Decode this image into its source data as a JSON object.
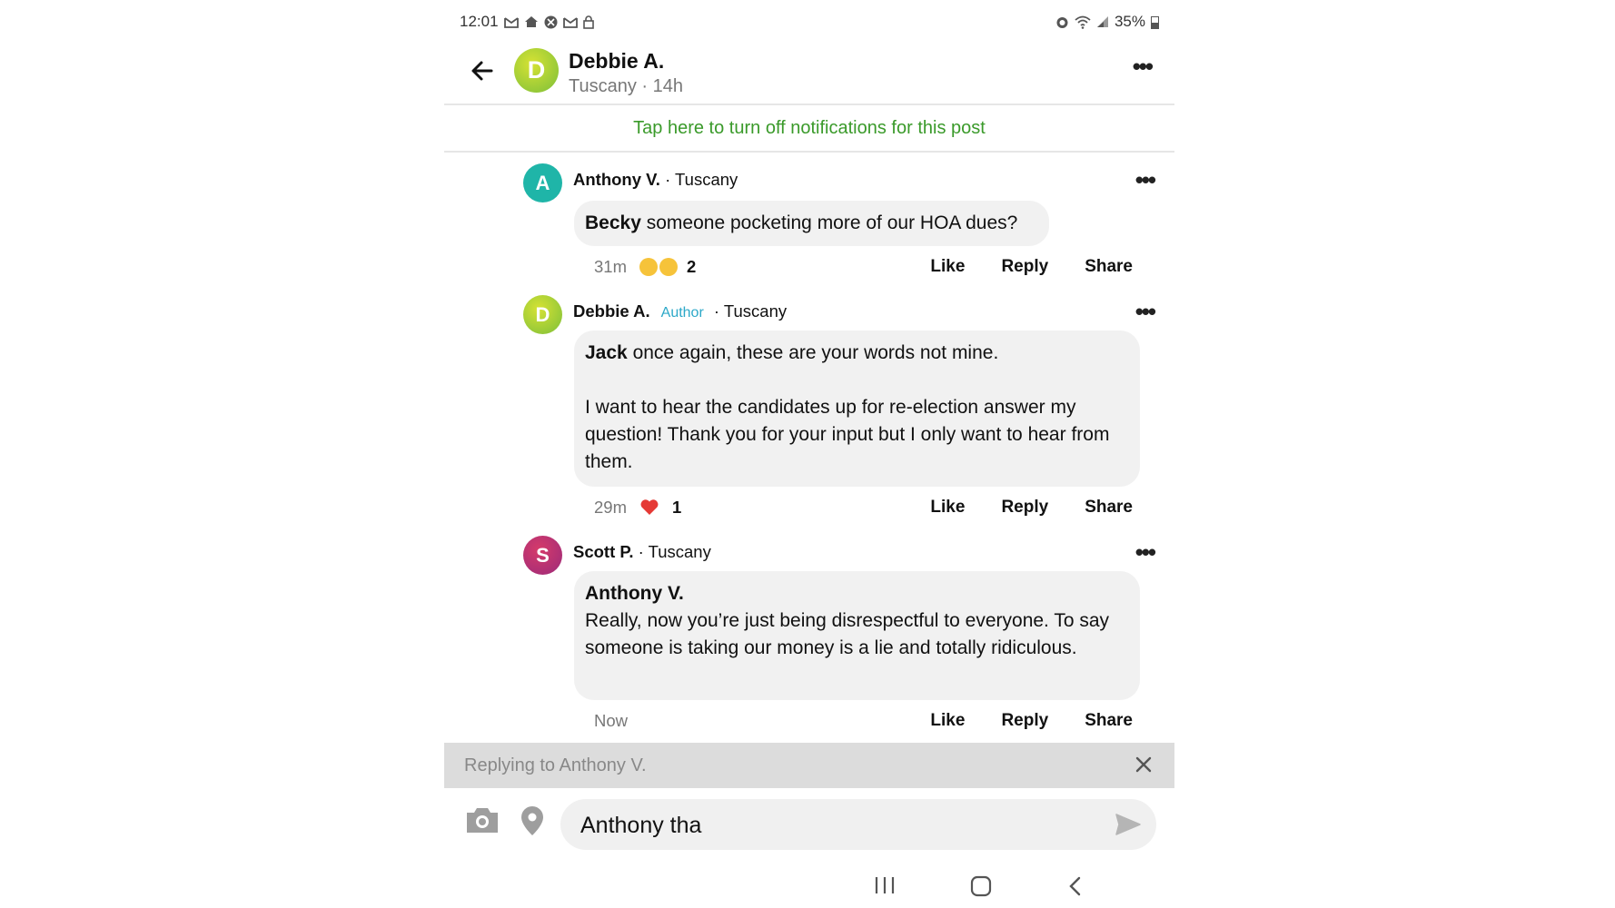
{
  "status_bar": {
    "time": "12:01",
    "battery": "35%",
    "left_icons": [
      "gmail-icon",
      "home-icon",
      "app-icon",
      "gmail-icon",
      "lock-icon"
    ],
    "right_icons": [
      "alarm-icon",
      "wifi-icon",
      "signal-icon",
      "battery-icon"
    ]
  },
  "header": {
    "avatar_letter": "D",
    "name": "Debbie A.",
    "neighborhood": "Tuscany",
    "time": "14h",
    "subtitle": "Tuscany · 14h"
  },
  "notification_banner": "Tap here to turn off notifications for this post",
  "comments": [
    {
      "avatar_letter": "A",
      "avatar_color": "#1fb5a8",
      "author": "Anthony V.",
      "location": " · Tuscany",
      "mention": "Becky",
      "text": "someone pocketing more of our HOA dues?",
      "time": "31m",
      "reactions": [
        "astonished-emoji-icon",
        "laughing-emoji-icon"
      ],
      "reaction_count": "2",
      "actions": {
        "like": "Like",
        "reply": "Reply",
        "share": "Share"
      }
    },
    {
      "avatar_letter": "D",
      "author": "Debbie A.",
      "badge": "Author",
      "location": " · Tuscany",
      "mention": "Jack",
      "text_line1": "once again, these are your words not mine.",
      "text_para2": "I want to hear the candidates up for re-election answer my question! Thank you for your input but I only want to hear from them.",
      "time": "29m",
      "reactions": [
        "heart-icon"
      ],
      "reaction_count": "1",
      "actions": {
        "like": "Like",
        "reply": "Reply",
        "share": "Share"
      }
    },
    {
      "avatar_letter": "S",
      "author": "Scott P.",
      "location": " · Tuscany",
      "mention": "Anthony V.",
      "text": "Really, now you’re just being disrespectful to everyone. To say someone is taking our money is a lie and totally ridiculous.",
      "time": "Now",
      "actions": {
        "like": "Like",
        "reply": "Reply",
        "share": "Share"
      }
    }
  ],
  "reply_banner": {
    "text": "Replying to Anthony V."
  },
  "composer": {
    "value": "Anthony tha"
  },
  "colors": {
    "accent_green": "#3a9a2a",
    "author_badge": "#2ca8c8"
  }
}
